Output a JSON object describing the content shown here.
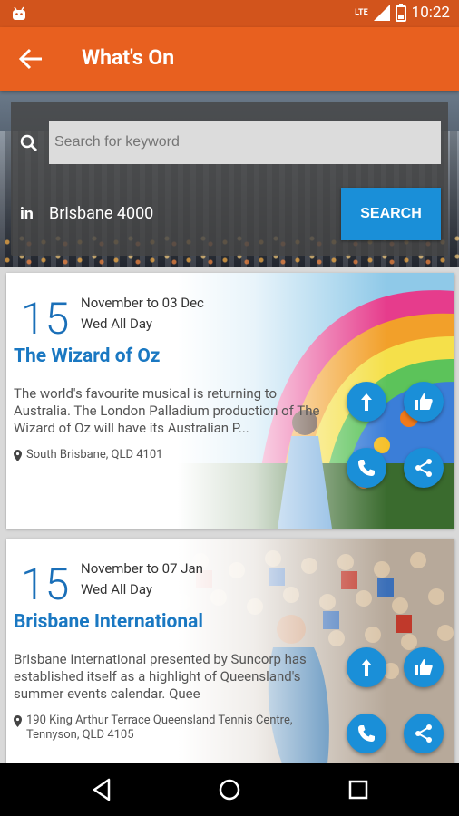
{
  "status_bar": {
    "network": "LTE",
    "time": "10:22"
  },
  "app_bar": {
    "title": "What's On"
  },
  "search": {
    "placeholder": "Search for keyword",
    "in_label": "in",
    "location": "Brisbane 4000",
    "button_label": "SEARCH"
  },
  "events": [
    {
      "day": "15",
      "range": "November to 03 Dec",
      "when": "Wed All Day",
      "title": "The Wizard of Oz",
      "description": "The world's favourite musical is returning to Australia. The London Palladium production of The Wizard of Oz will have its Australian P...",
      "address": "South Brisbane, QLD 4101"
    },
    {
      "day": "15",
      "range": "November to 07 Jan",
      "when": "Wed All Day",
      "title": "Brisbane International",
      "description": "Brisbane International presented by Suncorp has established itself as a highlight of Queensland's summer events calendar. Quee",
      "address": "190 King Arthur Terrace Queensland Tennis Centre, Tennyson, QLD 4105"
    }
  ],
  "colors": {
    "status": "#d2541c",
    "appbar": "#e8601f",
    "accent": "#1a8fd8",
    "title_blue": "#1a78c2"
  }
}
